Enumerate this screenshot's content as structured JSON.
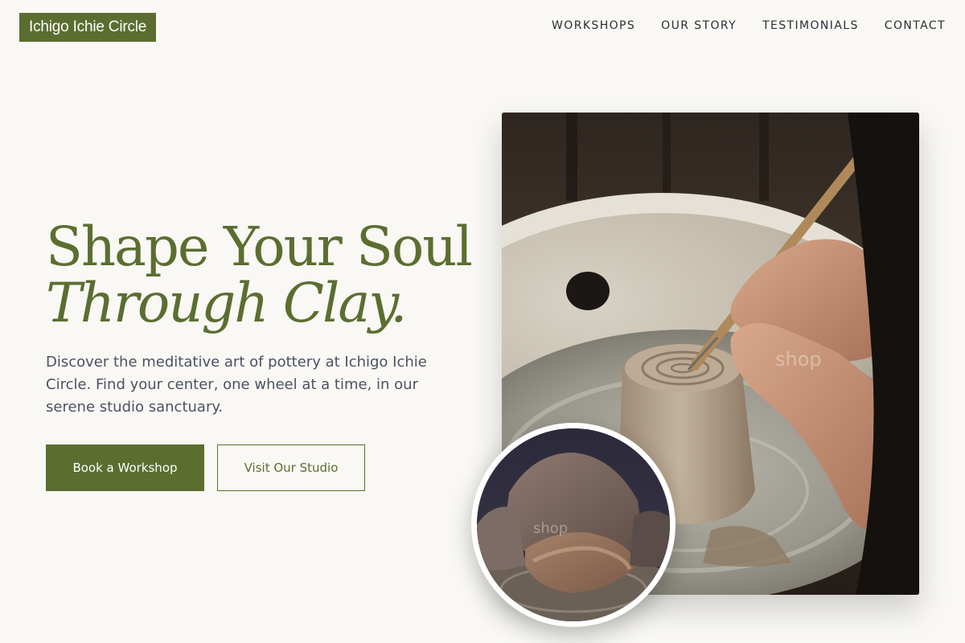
{
  "brand": {
    "name": "Ichigo Ichie Circle"
  },
  "nav": {
    "items": [
      {
        "label": "WORKSHOPS"
      },
      {
        "label": "OUR STORY"
      },
      {
        "label": "TESTIMONIALS"
      },
      {
        "label": "CONTACT"
      }
    ]
  },
  "hero": {
    "title_line1": "Shape Your Soul",
    "title_line2": "Through Clay.",
    "description": "Discover the meditative art of pottery at Ichigo Ichie Circle. Find your center, one wheel at a time, in our serene studio sanctuary.",
    "primary_cta": "Book a Workshop",
    "secondary_cta": "Visit Our Studio"
  },
  "images": {
    "main_photo": "pottery-wheel-carving-photo",
    "circle_photo": "hands-on-clay-photo",
    "watermark": "shop"
  },
  "colors": {
    "accent": "#5b6e30",
    "background": "#f9f8f4",
    "text": "#4b5263"
  }
}
